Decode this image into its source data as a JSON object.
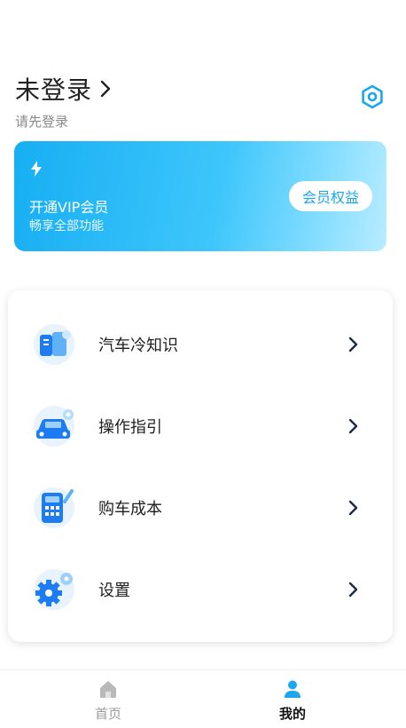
{
  "profile": {
    "title": "未登录",
    "subtitle": "请先登录"
  },
  "vip": {
    "title": "开通VIP会员",
    "subtitle": "畅享全部功能",
    "button_label": "会员权益"
  },
  "menu": {
    "items": [
      {
        "label": "汽车冷知识",
        "icon": "book-icon"
      },
      {
        "label": "操作指引",
        "icon": "car-gear-icon"
      },
      {
        "label": "购车成本",
        "icon": "calculator-icon"
      },
      {
        "label": "设置",
        "icon": "settings-gear-icon"
      }
    ]
  },
  "nav": {
    "tabs": [
      {
        "label": "首页",
        "icon": "home-icon"
      },
      {
        "label": "我的",
        "icon": "user-icon"
      }
    ]
  },
  "colors": {
    "accent": "#1aa7ef",
    "icon_blue": "#1e7cf2"
  }
}
